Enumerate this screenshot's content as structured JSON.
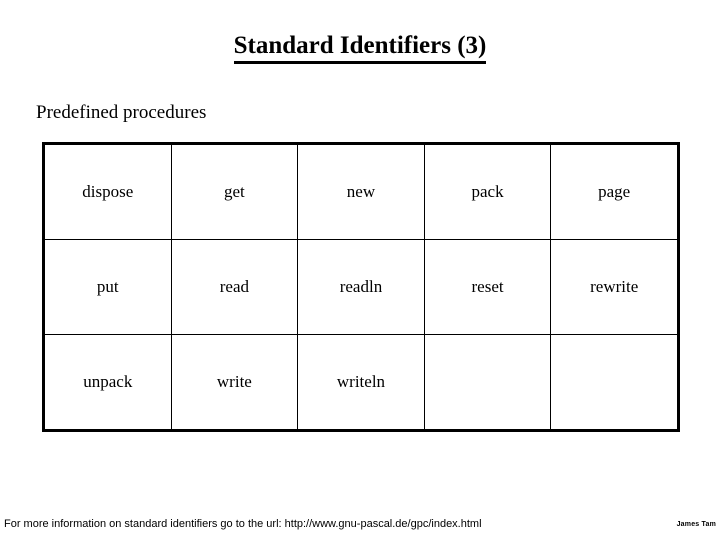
{
  "slide": {
    "title": "Standard Identifiers (3)",
    "subtitle": "Predefined procedures"
  },
  "table": {
    "rows": [
      [
        "dispose",
        "get",
        "new",
        "pack",
        "page"
      ],
      [
        "put",
        "read",
        "readln",
        "reset",
        "rewrite"
      ],
      [
        "unpack",
        "write",
        "writeln",
        "",
        ""
      ]
    ]
  },
  "footer": {
    "note": "For more information on standard identifiers go to the url: http://www.gnu-pascal.de/gpc/index.html",
    "credit": "James Tam"
  },
  "colors": {
    "text": "#000000",
    "background": "#ffffff",
    "border": "#000000"
  }
}
